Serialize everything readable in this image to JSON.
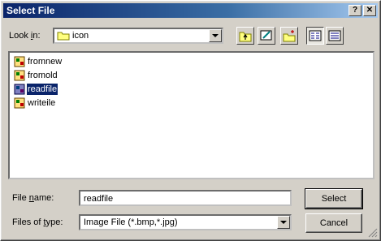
{
  "window": {
    "title": "Select File",
    "help_label": "?",
    "close_label": "✕"
  },
  "lookin": {
    "label_pre": "Look ",
    "label_ul": "i",
    "label_post": "n:",
    "value": "icon",
    "icon": "folder-icon"
  },
  "toolbar": {
    "icons": [
      "up-folder-icon",
      "desktop-icon",
      "new-folder-icon",
      "list-view-icon",
      "details-view-icon"
    ]
  },
  "files": [
    {
      "name": "fromnew",
      "selected": false
    },
    {
      "name": "fromold",
      "selected": false
    },
    {
      "name": "readfile",
      "selected": true
    },
    {
      "name": "writeile",
      "selected": false
    }
  ],
  "filename": {
    "label_pre": "File ",
    "label_ul": "n",
    "label_post": "ame:",
    "value": "readfile"
  },
  "filetype": {
    "label_pre": "Files of ",
    "label_ul": "t",
    "label_post": "ype:",
    "value": "Image File (*.bmp,*.jpg)"
  },
  "buttons": {
    "select": "Select",
    "cancel": "Cancel"
  },
  "colors": {
    "title_bar": "#0a246a",
    "selection": "#0a246a",
    "face": "#d4d0c8"
  }
}
